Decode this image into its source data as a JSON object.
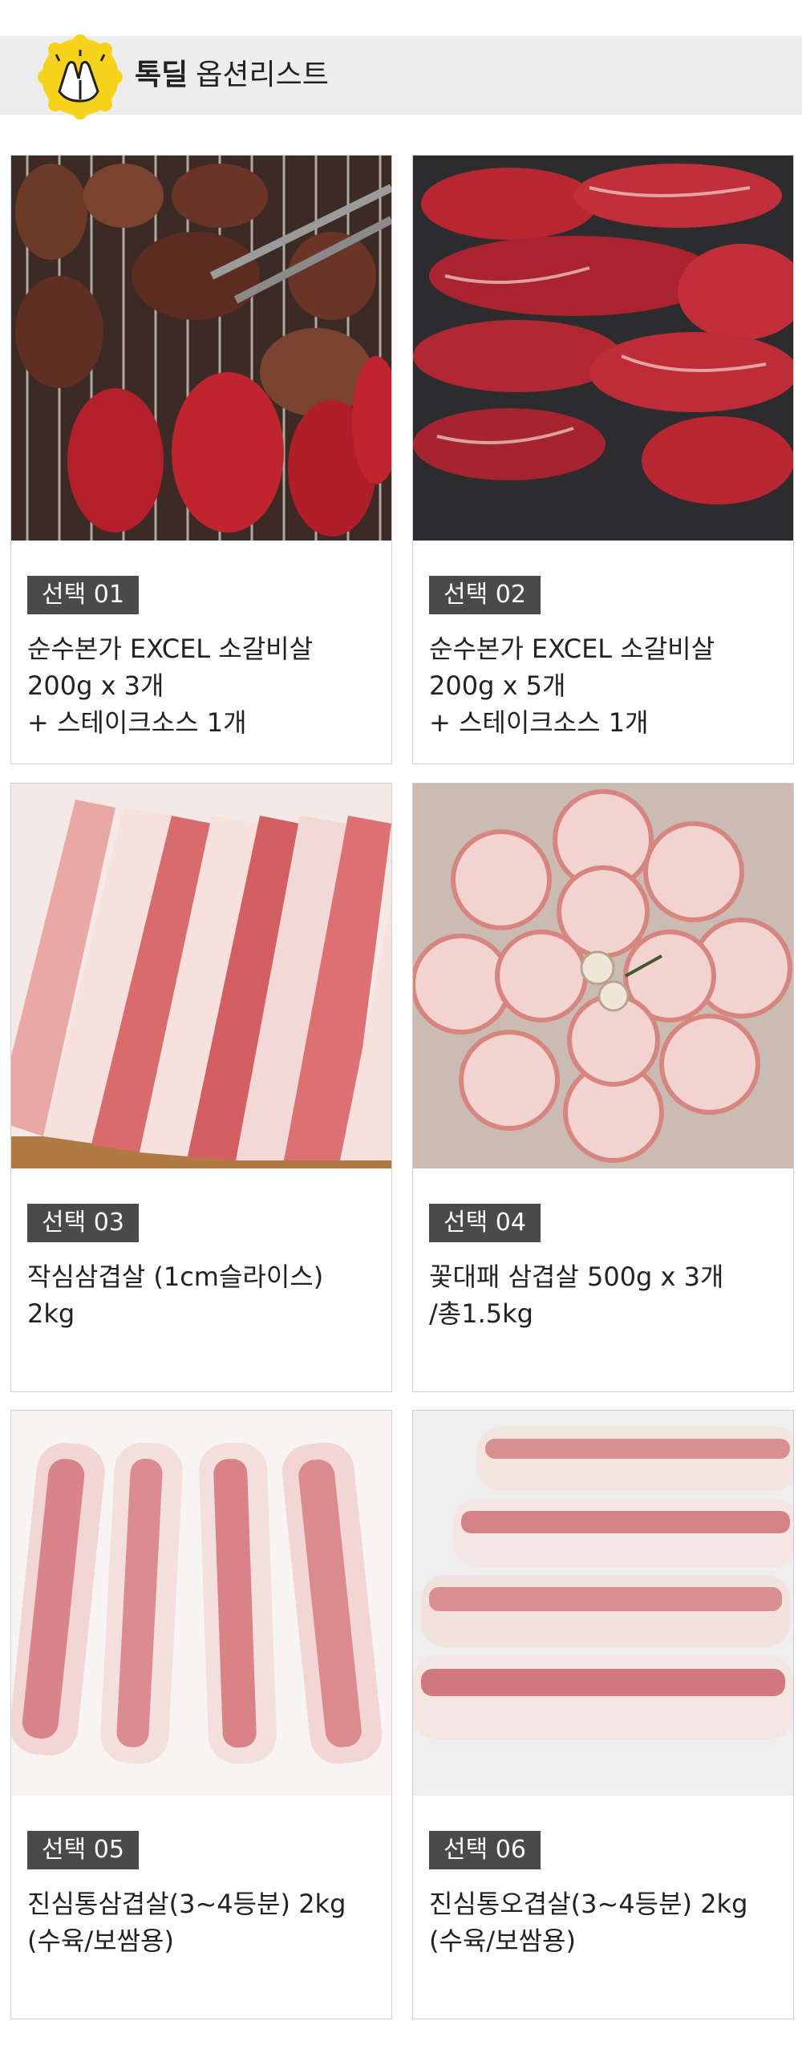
{
  "header": {
    "title_bold": "톡딜",
    "title_regular": "옵션리스트",
    "badge_icon": "clapping-hands-icon",
    "badge_color": "#f7d21a"
  },
  "options": [
    {
      "tag": "선택 01",
      "lines": [
        "순수본가 EXCEL 소갈비살",
        "200g x 3개",
        "+ 스테이크소스 1개"
      ],
      "image": "grilled-beef-rib-photo"
    },
    {
      "tag": "선택 02",
      "lines": [
        "순수본가 EXCEL 소갈비살",
        "200g x 5개",
        "+ 스테이크소스 1개"
      ],
      "image": "raw-beef-rib-photo"
    },
    {
      "tag": "선택 03",
      "lines": [
        "작심삼겹살 (1cm슬라이스)",
        "2kg"
      ],
      "image": "sliced-pork-belly-photo"
    },
    {
      "tag": "선택 04",
      "lines": [
        "꽃대패 삼겹살 500g x 3개",
        "/총1.5kg"
      ],
      "image": "rolled-pork-belly-flower-photo"
    },
    {
      "tag": "선택 05",
      "lines": [
        "진심통삼겹살(3~4등분) 2kg",
        "(수육/보쌈용)"
      ],
      "image": "whole-pork-belly-strips-photo"
    },
    {
      "tag": "선택 06",
      "lines": [
        "진심통오겹살(3~4등분) 2kg",
        "(수육/보쌈용)"
      ],
      "image": "whole-pork-skin-on-belly-photo"
    }
  ]
}
